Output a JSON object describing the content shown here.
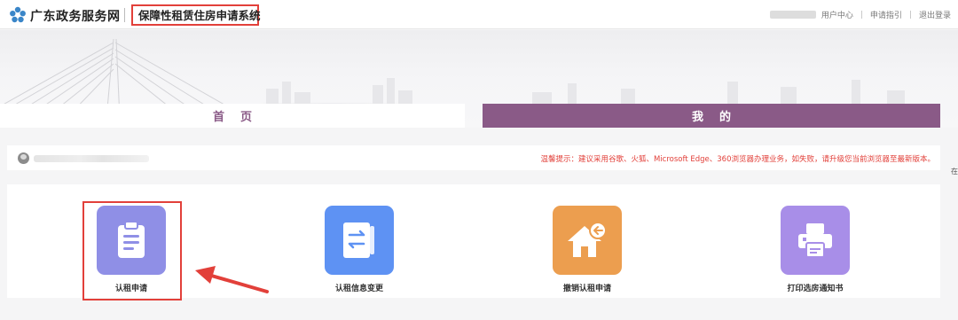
{
  "header": {
    "brand": "广东政务服务网",
    "system_title": "保障性租赁住房申请系统",
    "links": [
      "用户中心",
      "申请指引",
      "退出登录"
    ]
  },
  "nav": {
    "home_label": "首页",
    "mine_label": "我的"
  },
  "infobar": {
    "tip": "温馨提示：建议采用谷歌、火狐、Microsoft Edge、360浏览器办理业务，如失败，请升级您当前浏览器至最新版本。",
    "edge_char": "在"
  },
  "services": [
    {
      "label": "认租申请",
      "icon": "clipboard-icon",
      "color": "#8f8fe6"
    },
    {
      "label": "认租信息变更",
      "icon": "swap-document-icon",
      "color": "#5e92f3"
    },
    {
      "label": "撤销认租申请",
      "icon": "house-undo-icon",
      "color": "#ec9e4f"
    },
    {
      "label": "打印选房通知书",
      "icon": "printer-icon",
      "color": "#a88ee8"
    }
  ],
  "colors": {
    "accent": "#8a5a87",
    "highlight": "#e2403a"
  }
}
